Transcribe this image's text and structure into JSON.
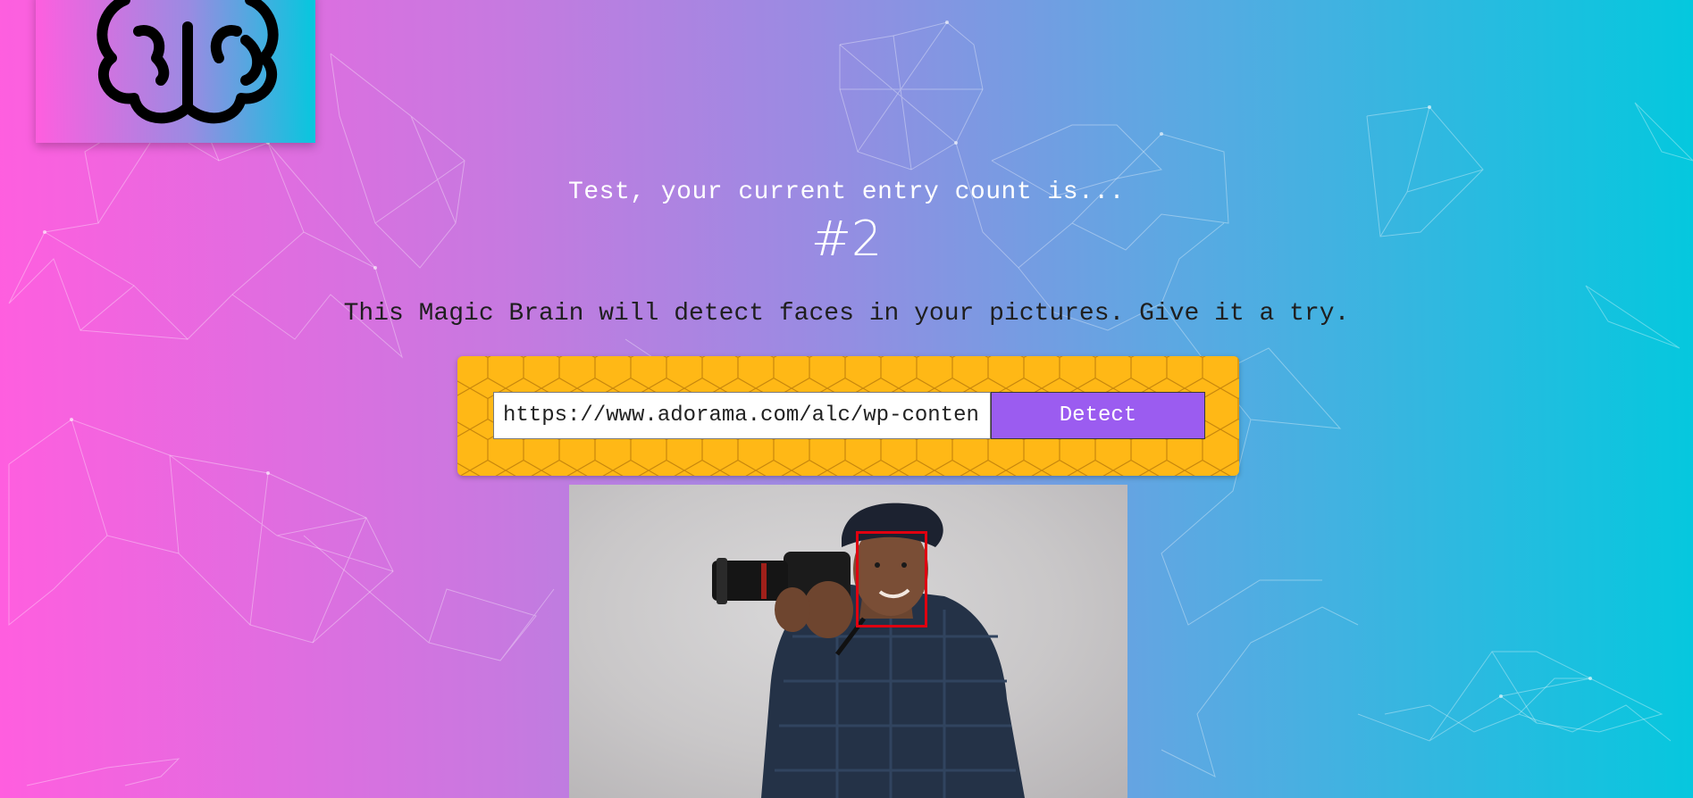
{
  "app": {
    "entry_message": "Test, your current entry count is...",
    "entry_count": "#2",
    "description": "This Magic Brain will detect faces in your pictures. Give it a try."
  },
  "form": {
    "url_value": "https://www.adorama.com/alc/wp-content",
    "detect_label": "Detect"
  },
  "icons": {
    "logo": "brain-icon"
  },
  "colors": {
    "gradient_left": "#ff5edf",
    "gradient_right": "#04c8de",
    "panel_yellow": "#ffb816",
    "button_purple": "#9b5cf0",
    "face_box_red": "#e00010"
  }
}
